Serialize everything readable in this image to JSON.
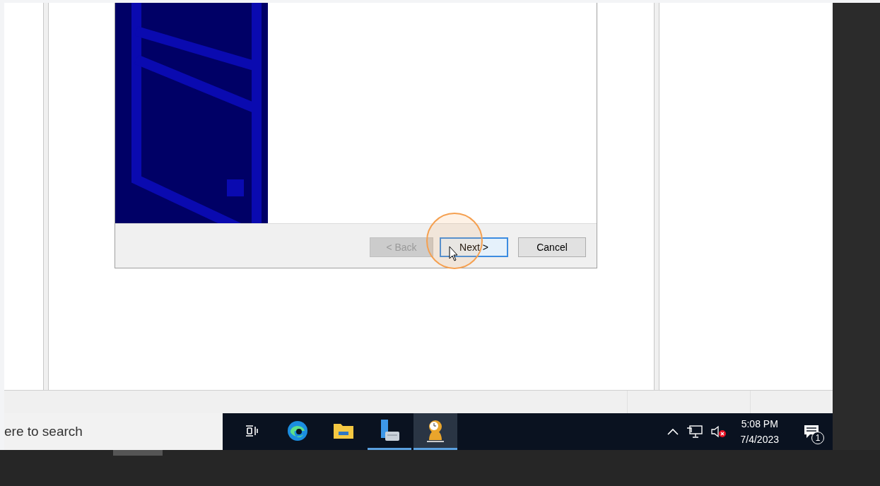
{
  "dialog": {
    "buttons": [
      {
        "label": "< Back",
        "disabled": true,
        "focused": false
      },
      {
        "label": "Next >",
        "disabled": false,
        "focused": true
      },
      {
        "label": "Cancel",
        "disabled": false,
        "focused": false
      }
    ]
  },
  "taskbar": {
    "search": {
      "placeholder": "ere to search"
    },
    "apps": [
      {
        "kind": "taskview",
        "running": false,
        "active": false
      },
      {
        "kind": "browser",
        "running": false,
        "active": false
      },
      {
        "kind": "folder",
        "running": false,
        "active": false
      },
      {
        "kind": "server",
        "running": true,
        "active": false
      },
      {
        "kind": "clockperson",
        "running": true,
        "active": true
      }
    ],
    "clock": {
      "time": "5:08 PM",
      "date": "7/4/2023"
    },
    "notifications": {
      "count": "1"
    }
  }
}
